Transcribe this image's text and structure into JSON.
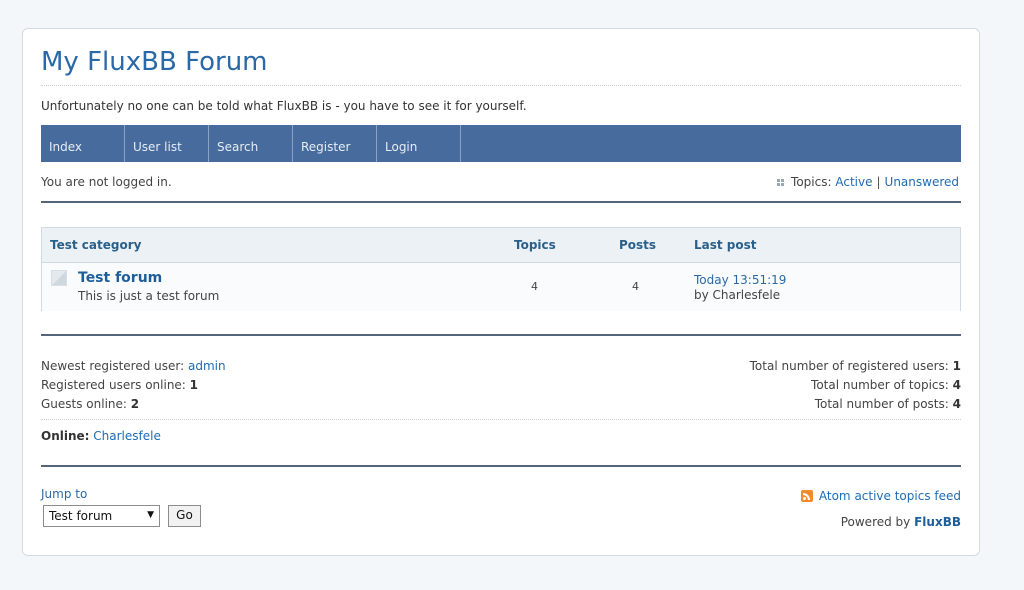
{
  "header": {
    "title": "My FluxBB Forum",
    "description": "Unfortunately no one can be told what FluxBB is - you have to see it for yourself."
  },
  "nav": {
    "items": [
      {
        "label": "Index"
      },
      {
        "label": "User list"
      },
      {
        "label": "Search"
      },
      {
        "label": "Register"
      },
      {
        "label": "Login"
      }
    ]
  },
  "status": {
    "login_text": "You are not logged in.",
    "topics_label": "Topics:",
    "active_link": "Active",
    "separator": "|",
    "unanswered_link": "Unanswered"
  },
  "category": {
    "name": "Test category",
    "col_topics": "Topics",
    "col_posts": "Posts",
    "col_last_post": "Last post",
    "forums": [
      {
        "name": "Test forum",
        "description": "This is just a test forum",
        "topics": "4",
        "posts": "4",
        "last_post_time": "Today 13:51:19",
        "last_post_by": "by Charlesfele"
      }
    ]
  },
  "stats": {
    "newest_user_label": "Newest registered user:",
    "newest_user": "admin",
    "users_online_label": "Registered users online:",
    "users_online": "1",
    "guests_online_label": "Guests online:",
    "guests_online": "2",
    "total_users_label": "Total number of registered users:",
    "total_users": "1",
    "total_topics_label": "Total number of topics:",
    "total_topics": "4",
    "total_posts_label": "Total number of posts:",
    "total_posts": "4",
    "online_label": "Online:",
    "online_user": "Charlesfele"
  },
  "footer": {
    "jump_to_label": "Jump to",
    "jump_selected": "Test forum",
    "go_label": "Go",
    "feed_link": "Atom active topics feed",
    "powered_by_label": "Powered by",
    "powered_by_link": "FluxBB"
  },
  "colors": {
    "nav_bg": "#466b9c",
    "title": "#2a69a8",
    "link": "#1e6cb4",
    "rss": "#f08c2e"
  },
  "icons": [
    "grid-bullet-icon",
    "forum-status-icon",
    "rss-feed-icon",
    "dropdown-arrow-icon"
  ]
}
